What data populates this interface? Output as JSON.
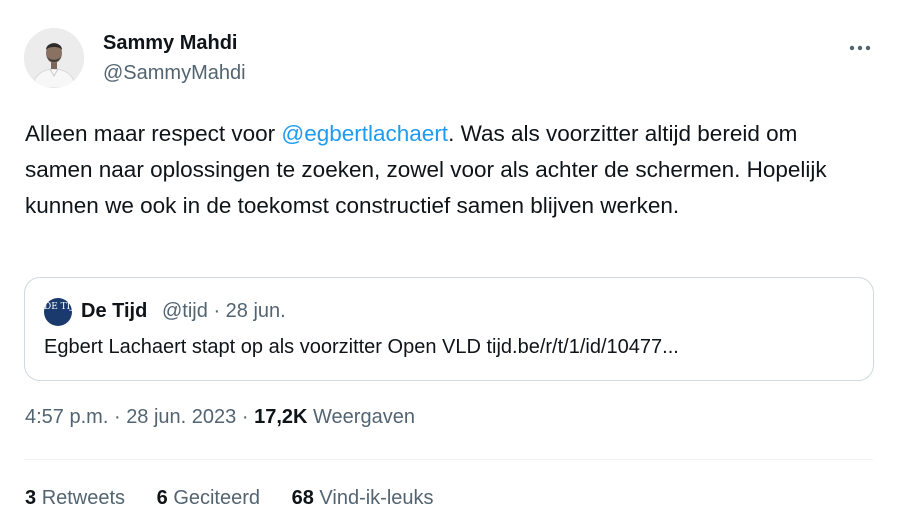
{
  "author": {
    "name": "Sammy Mahdi",
    "handle": "@SammyMahdi"
  },
  "tweet": {
    "text_before": "Alleen maar respect voor ",
    "mention": "@egbertlachaert",
    "text_after": ". Was als voorzitter altijd bereid om samen naar oplossingen te zoeken, zowel voor als achter de schermen. Hopelijk kunnen we ook in de toekomst constructief samen blijven werken."
  },
  "quoted": {
    "logo_text": "DE TIJD",
    "name": "De Tijd",
    "handle": "@tijd",
    "separator": "·",
    "date": "28 jun.",
    "text": "Egbert Lachaert stapt op als voorzitter Open VLD tijd.be/r/t/1/id/10477..."
  },
  "meta": {
    "time": "4:57 p.m.",
    "sep1": "·",
    "date": "28 jun. 2023",
    "sep2": "·",
    "views_count": "17,2K",
    "views_label": "Weergaven"
  },
  "stats": {
    "retweets_count": "3",
    "retweets_label": "Retweets",
    "quotes_count": "6",
    "quotes_label": "Geciteerd",
    "likes_count": "68",
    "likes_label": "Vind-ik-leuks"
  },
  "icons": {
    "more": "more-horizontal-icon",
    "avatar": "user-avatar"
  },
  "colors": {
    "text": "#0f1419",
    "secondary": "#536471",
    "link": "#1d9bf0",
    "border": "#cfd9de",
    "logo_bg": "#1a3a6e"
  }
}
